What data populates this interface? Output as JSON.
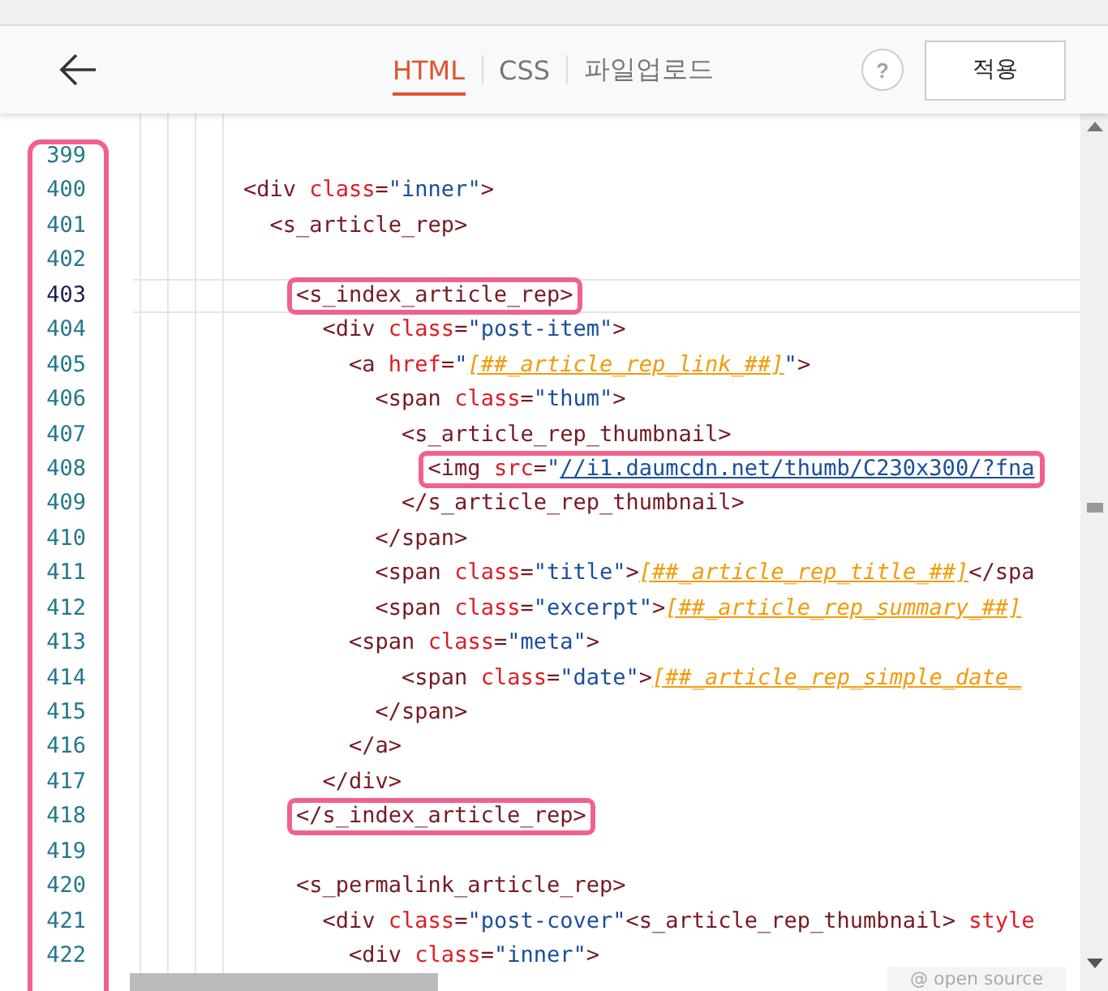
{
  "header": {
    "tabs": [
      {
        "label": "HTML",
        "selected": true
      },
      {
        "label": "CSS",
        "selected": false
      },
      {
        "label": "파일업로드",
        "selected": false
      }
    ],
    "help": "?",
    "apply_button": "적용"
  },
  "editor": {
    "line_numbers_highlighted": true,
    "footer": "@ open source",
    "lines": [
      {
        "number": "399",
        "current": false
      },
      {
        "number": "400",
        "current": false,
        "highlighted": false,
        "tokens": [
          {
            "kind": "tag",
            "text": "<div "
          },
          {
            "kind": "attr",
            "text": "class"
          },
          {
            "kind": "tag",
            "text": "="
          },
          {
            "kind": "str",
            "text": "\"inner\""
          },
          {
            "kind": "tag",
            "text": ">"
          }
        ]
      },
      {
        "number": "401",
        "current": false,
        "highlighted": false,
        "tokens": [
          {
            "kind": "tag",
            "text": "  <s_article_rep>"
          }
        ]
      },
      {
        "number": "402",
        "current": false
      },
      {
        "number": "403",
        "current": true,
        "highlighted": true,
        "tokens": [
          {
            "kind": "tag",
            "text": "    <s_index_article_rep>"
          }
        ]
      },
      {
        "number": "404",
        "current": false,
        "highlighted": false,
        "tokens": [
          {
            "kind": "tag",
            "text": "      <div "
          },
          {
            "kind": "attr",
            "text": "class"
          },
          {
            "kind": "tag",
            "text": "="
          },
          {
            "kind": "str",
            "text": "\"post-item\""
          },
          {
            "kind": "tag",
            "text": ">"
          }
        ]
      },
      {
        "number": "405",
        "current": false,
        "highlighted": false,
        "tokens": [
          {
            "kind": "tag",
            "text": "        <a "
          },
          {
            "kind": "attr",
            "text": "href"
          },
          {
            "kind": "tag",
            "text": "="
          },
          {
            "kind": "str",
            "text": "\""
          },
          {
            "kind": "tpl",
            "text": "[##_article_rep_link_##]"
          },
          {
            "kind": "str",
            "text": "\""
          },
          {
            "kind": "tag",
            "text": ">"
          }
        ]
      },
      {
        "number": "406",
        "current": false,
        "highlighted": false,
        "tokens": [
          {
            "kind": "tag",
            "text": "          <span "
          },
          {
            "kind": "attr",
            "text": "class"
          },
          {
            "kind": "tag",
            "text": "="
          },
          {
            "kind": "str",
            "text": "\"thum\""
          },
          {
            "kind": "tag",
            "text": ">"
          }
        ]
      },
      {
        "number": "407",
        "current": false,
        "highlighted": false,
        "tokens": [
          {
            "kind": "tag",
            "text": "            <s_article_rep_thumbnail>"
          }
        ]
      },
      {
        "number": "408",
        "current": false,
        "highlighted": true,
        "tokens": [
          {
            "kind": "tag",
            "text": "              <img "
          },
          {
            "kind": "attr",
            "text": "src"
          },
          {
            "kind": "tag",
            "text": "="
          },
          {
            "kind": "str",
            "text": "\""
          },
          {
            "kind": "url",
            "text": "//i1.daumcdn.net/thumb/C230x300/?fna"
          }
        ]
      },
      {
        "number": "409",
        "current": false,
        "highlighted": false,
        "tokens": [
          {
            "kind": "tag",
            "text": "            </s_article_rep_thumbnail>"
          }
        ]
      },
      {
        "number": "410",
        "current": false,
        "highlighted": false,
        "tokens": [
          {
            "kind": "tag",
            "text": "          </span>"
          }
        ]
      },
      {
        "number": "411",
        "current": false,
        "highlighted": false,
        "tokens": [
          {
            "kind": "tag",
            "text": "          <span "
          },
          {
            "kind": "attr",
            "text": "class"
          },
          {
            "kind": "tag",
            "text": "="
          },
          {
            "kind": "str",
            "text": "\"title\""
          },
          {
            "kind": "tag",
            "text": ">"
          },
          {
            "kind": "tpl",
            "text": "[##_article_rep_title_##]"
          },
          {
            "kind": "tag",
            "text": "</spa"
          }
        ]
      },
      {
        "number": "412",
        "current": false,
        "highlighted": false,
        "tokens": [
          {
            "kind": "tag",
            "text": "          <span "
          },
          {
            "kind": "attr",
            "text": "class"
          },
          {
            "kind": "tag",
            "text": "="
          },
          {
            "kind": "str",
            "text": "\"excerpt\""
          },
          {
            "kind": "tag",
            "text": ">"
          },
          {
            "kind": "tpl",
            "text": "[##_article_rep_summary_##]"
          }
        ]
      },
      {
        "number": "413",
        "current": false,
        "highlighted": false,
        "tokens": [
          {
            "kind": "tag",
            "text": "        <span "
          },
          {
            "kind": "attr",
            "text": "class"
          },
          {
            "kind": "tag",
            "text": "="
          },
          {
            "kind": "str",
            "text": "\"meta\""
          },
          {
            "kind": "tag",
            "text": ">"
          }
        ]
      },
      {
        "number": "414",
        "current": false,
        "highlighted": false,
        "tokens": [
          {
            "kind": "tag",
            "text": "            <span "
          },
          {
            "kind": "attr",
            "text": "class"
          },
          {
            "kind": "tag",
            "text": "="
          },
          {
            "kind": "str",
            "text": "\"date\""
          },
          {
            "kind": "tag",
            "text": ">"
          },
          {
            "kind": "tpl",
            "text": "[##_article_rep_simple_date_"
          }
        ]
      },
      {
        "number": "415",
        "current": false,
        "highlighted": false,
        "tokens": [
          {
            "kind": "tag",
            "text": "          </span>"
          }
        ]
      },
      {
        "number": "416",
        "current": false,
        "highlighted": false,
        "tokens": [
          {
            "kind": "tag",
            "text": "        </a>"
          }
        ]
      },
      {
        "number": "417",
        "current": false,
        "highlighted": false,
        "tokens": [
          {
            "kind": "tag",
            "text": "      </div>"
          }
        ]
      },
      {
        "number": "418",
        "current": false,
        "highlighted": true,
        "tokens": [
          {
            "kind": "tag",
            "text": "    </s_index_article_rep>"
          }
        ]
      },
      {
        "number": "419",
        "current": false
      },
      {
        "number": "420",
        "current": false,
        "highlighted": false,
        "tokens": [
          {
            "kind": "tag",
            "text": "    <s_permalink_article_rep>"
          }
        ]
      },
      {
        "number": "421",
        "current": false,
        "highlighted": false,
        "tokens": [
          {
            "kind": "tag",
            "text": "      <div "
          },
          {
            "kind": "attr",
            "text": "class"
          },
          {
            "kind": "tag",
            "text": "="
          },
          {
            "kind": "str",
            "text": "\"post-cover\""
          },
          {
            "kind": "tag",
            "text": "<s_article_rep_thumbnail> "
          },
          {
            "kind": "attr",
            "text": "style"
          }
        ]
      },
      {
        "number": "422",
        "current": false,
        "highlighted": false,
        "tokens": [
          {
            "kind": "tag",
            "text": "        <div "
          },
          {
            "kind": "attr",
            "text": "class"
          },
          {
            "kind": "tag",
            "text": "="
          },
          {
            "kind": "str",
            "text": "\"inner\""
          },
          {
            "kind": "tag",
            "text": ">"
          }
        ]
      }
    ]
  }
}
